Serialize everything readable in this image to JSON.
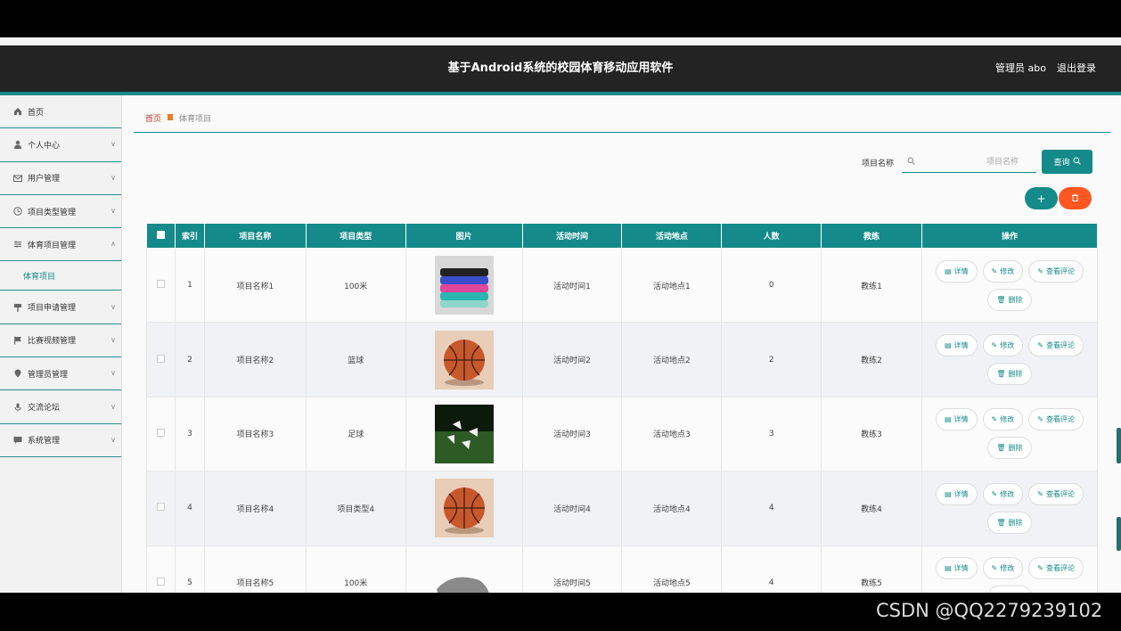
{
  "header": {
    "title": "基于Android系统的校园体育移动应用软件",
    "admin": "管理员 abo",
    "logout": "退出登录"
  },
  "sidebar": {
    "items": [
      {
        "label": "首页",
        "icon": "home-icon"
      },
      {
        "label": "个人中心",
        "icon": "user-icon"
      },
      {
        "label": "用户管理",
        "icon": "mail-icon"
      },
      {
        "label": "项目类型管理",
        "icon": "clock-icon"
      },
      {
        "label": "体育项目管理",
        "icon": "sliders-icon"
      },
      {
        "label": "项目申请管理",
        "icon": "sign-icon"
      },
      {
        "label": "比赛视频管理",
        "icon": "flag-icon"
      },
      {
        "label": "管理员管理",
        "icon": "pin-icon"
      },
      {
        "label": "交流论坛",
        "icon": "mic-icon"
      },
      {
        "label": "系统管理",
        "icon": "chat-icon"
      }
    ],
    "sub_item": "体育项目"
  },
  "breadcrumb": {
    "home": "首页",
    "current": "体育项目"
  },
  "search": {
    "label": "项目名称",
    "placeholder": "项目名称",
    "button": "查询"
  },
  "table": {
    "headers": [
      "索引",
      "项目名称",
      "项目类型",
      "图片",
      "活动时间",
      "活动地点",
      "人数",
      "教练",
      "操作"
    ],
    "rows": [
      {
        "index": "1",
        "name": "项目名称1",
        "type": "100米",
        "image": "resistance-bands",
        "time": "活动时间1",
        "place": "活动地点1",
        "count": "0",
        "coach": "教练1"
      },
      {
        "index": "2",
        "name": "项目名称2",
        "type": "篮球",
        "image": "basketball",
        "time": "活动时间2",
        "place": "活动地点2",
        "count": "2",
        "coach": "教练2"
      },
      {
        "index": "3",
        "name": "项目名称3",
        "type": "足球",
        "image": "shuttlecocks-on-grass",
        "time": "活动时间3",
        "place": "活动地点3",
        "count": "3",
        "coach": "教练3"
      },
      {
        "index": "4",
        "name": "项目名称4",
        "type": "项目类型4",
        "image": "basketball",
        "time": "活动时间4",
        "place": "活动地点4",
        "count": "4",
        "coach": "教练4"
      },
      {
        "index": "5",
        "name": "项目名称5",
        "type": "100米",
        "image": "gray-cloth",
        "time": "活动时间5",
        "place": "活动地点5",
        "count": "4",
        "coach": "教练5"
      }
    ],
    "actions": {
      "detail": "详情",
      "edit": "修改",
      "comments": "查看评论",
      "delete": "删除"
    }
  },
  "watermark": "CSDN @QQ2279239102",
  "colors": {
    "accent": "#148a8a",
    "danger": "#ff5722",
    "header_bg": "#232323"
  }
}
